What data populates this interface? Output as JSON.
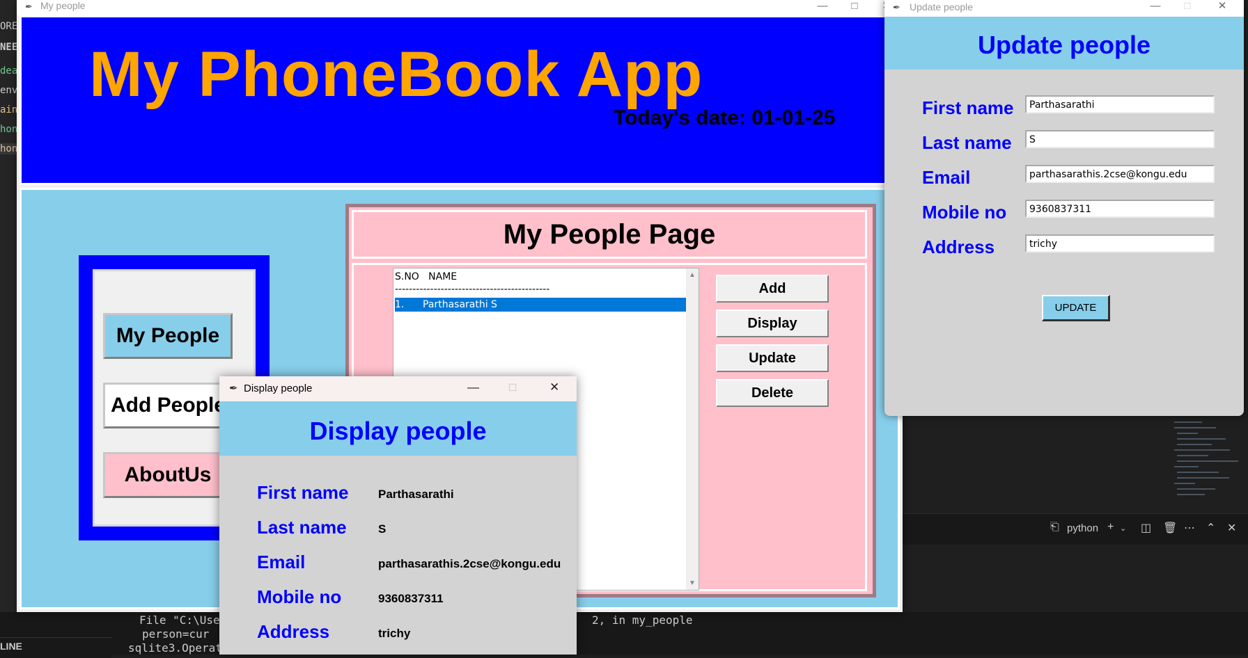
{
  "ide": {
    "left_fragments": [
      "ORE",
      "NEE",
      "dea",
      "env",
      "ain",
      "hon",
      "hon"
    ],
    "status_left": "LINE",
    "terminal_lines": [
      "File \"C:\\User",
      "person=cur",
      "sqlite3.Operat"
    ],
    "terminal_tail": "2, in my_people",
    "terminal_profile": "python"
  },
  "main_window": {
    "title": "My people",
    "app_title": "My PhoneBook App",
    "today_label": "Today's date: 01-01-25",
    "nav": {
      "my_people": "My People",
      "add_people": "Add People",
      "about_us": "AboutUs"
    },
    "people_page": {
      "title": "My People Page",
      "list_header": "S.NO   NAME",
      "list_divider": "--------------------------------------------",
      "rows": [
        "1.      Parthasarathi S"
      ],
      "buttons": {
        "add": "Add",
        "display": "Display",
        "update": "Update",
        "delete": "Delete"
      }
    }
  },
  "update_window": {
    "title": "Update people",
    "heading": "Update people",
    "labels": {
      "first_name": "First name",
      "last_name": "Last name",
      "email": "Email",
      "mobile": "Mobile no",
      "address": "Address"
    },
    "values": {
      "first_name": "Parthasarathi",
      "last_name": "S",
      "email": "parthasarathis.2cse@kongu.edu",
      "mobile": "9360837311",
      "address": "trichy"
    },
    "button": "UPDATE"
  },
  "display_window": {
    "title": "Display people",
    "heading": "Display people",
    "labels": {
      "first_name": "First name",
      "last_name": "Last name",
      "email": "Email",
      "mobile": "Mobile no",
      "address": "Address"
    },
    "values": {
      "first_name": "Parthasarathi",
      "last_name": "S",
      "email": "parthasarathis.2cse@kongu.edu",
      "mobile": "9360837311",
      "address": "trichy"
    }
  },
  "colors": {
    "header_blue": "#0000ff",
    "title_orange": "#ffa500",
    "sky": "#87ceeb",
    "pink": "#ffc0cb",
    "selection": "#0078d7"
  }
}
